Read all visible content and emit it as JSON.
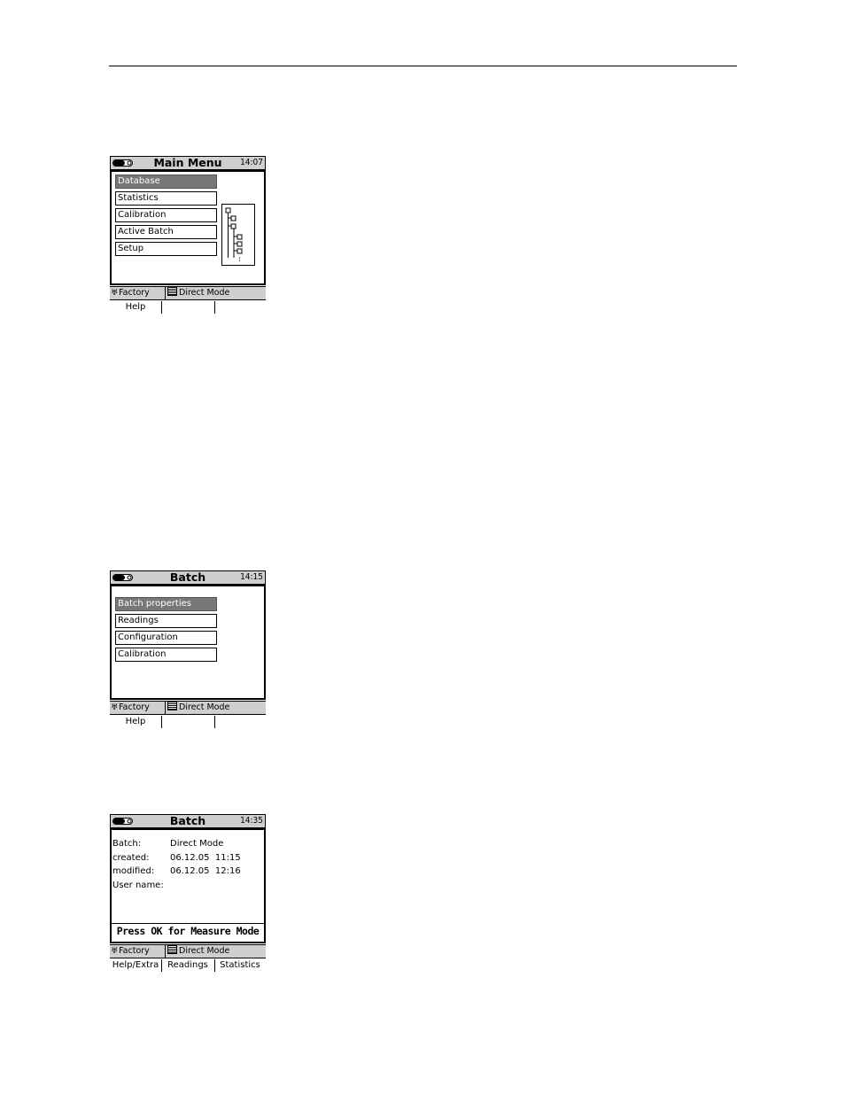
{
  "screens": [
    {
      "title": "Main Menu",
      "time": "14:07",
      "menu": [
        "Database",
        "Statistics",
        "Calibration",
        "Active Batch",
        "Setup"
      ],
      "selected_index": 0,
      "status": {
        "left": "Factory",
        "right": "Direct Mode"
      },
      "softkeys": [
        "Help",
        "",
        ""
      ]
    },
    {
      "title": "Batch",
      "time": "14:15",
      "menu": [
        "Batch properties",
        "Readings",
        "Configuration",
        "Calibration"
      ],
      "selected_index": 0,
      "status": {
        "left": "Factory",
        "right": "Direct Mode"
      },
      "softkeys": [
        "Help",
        "",
        ""
      ]
    },
    {
      "title": "Batch",
      "time": "14:35",
      "info": [
        {
          "key": "Batch:",
          "value": "Direct Mode"
        },
        {
          "key": "created:",
          "value": "06.12.05  11:15"
        },
        {
          "key": "modified:",
          "value": "06.12.05  12:16"
        },
        {
          "key": "User name:",
          "value": ""
        }
      ],
      "prompt": "Press OK for Measure Mode",
      "status": {
        "left": "Factory",
        "right": "Direct Mode"
      },
      "softkeys": [
        "Help/Extra",
        "Readings",
        "Statistics"
      ]
    }
  ],
  "icons": {
    "battery": "battery-icon",
    "tree": "menu-tree-icon",
    "factory": "factory-icon",
    "list": "list-icon"
  }
}
